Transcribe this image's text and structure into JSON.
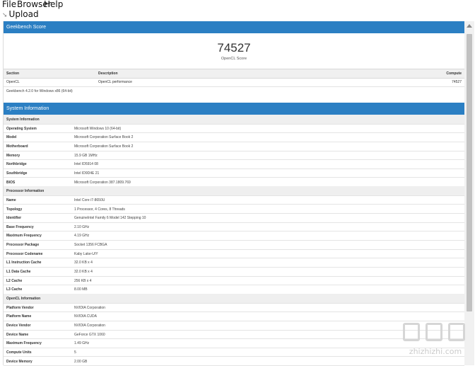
{
  "menu": {
    "file": "File",
    "browser": "Browser",
    "help": "Help"
  },
  "toolbar": {
    "upload": "Upload"
  },
  "score_panel": {
    "title": "Geekbench Score",
    "score": "74527",
    "score_label": "OpenCL Score",
    "headers": {
      "section": "Section",
      "description": "Description",
      "compute": "Compute"
    },
    "row": {
      "section": "OpenCL",
      "description": "OpenCL performance",
      "compute": "74527"
    },
    "version": "Geekbench 4.2.0 for Windows x86 (64-bit)"
  },
  "system_panel": {
    "title": "System Information",
    "rows": [
      {
        "key": "System Information",
        "value": "",
        "section": true
      },
      {
        "key": "Operating System",
        "value": "Microsoft Windows 10 (64-bit)"
      },
      {
        "key": "Model",
        "value": "Microsoft Corporation Surface Book 2"
      },
      {
        "key": "Motherboard",
        "value": "Microsoft Corporation Surface Book 2"
      },
      {
        "key": "Memory",
        "value": "15.9 GB 1MHz"
      },
      {
        "key": "Northbridge",
        "value": "Intel ID5914 08"
      },
      {
        "key": "Southbridge",
        "value": "Intel ID9D4E 21"
      },
      {
        "key": "BIOS",
        "value": "Microsoft Corporation 387.1809.769"
      },
      {
        "key": "Processor Information",
        "value": "",
        "section": true
      },
      {
        "key": "Name",
        "value": "Intel Core i7-8650U"
      },
      {
        "key": "Topology",
        "value": "1 Processor, 4 Cores, 8 Threads"
      },
      {
        "key": "Identifier",
        "value": "GenuineIntel Family 6 Model 142 Stepping 10"
      },
      {
        "key": "Base Frequency",
        "value": "2.10 GHz"
      },
      {
        "key": "Maximum Frequency",
        "value": "4.19 GHz"
      },
      {
        "key": "Processor Package",
        "value": "Socket 1356 FCBGA"
      },
      {
        "key": "Processor Codename",
        "value": "Kaby Lake-U/Y"
      },
      {
        "key": "L1 Instruction Cache",
        "value": "32.0 KB x 4"
      },
      {
        "key": "L1 Data Cache",
        "value": "32.0 KB x 4"
      },
      {
        "key": "L2 Cache",
        "value": "256 KB x 4"
      },
      {
        "key": "L3 Cache",
        "value": "8.00 MB"
      },
      {
        "key": "OpenCL Information",
        "value": "",
        "section": true
      },
      {
        "key": "Platform Vendor",
        "value": "NVIDIA Corporation"
      },
      {
        "key": "Platform Name",
        "value": "NVIDIA CUDA"
      },
      {
        "key": "Device Vendor",
        "value": "NVIDIA Corporation"
      },
      {
        "key": "Device Name",
        "value": "GeForce GTX 1060"
      },
      {
        "key": "Maximum Frequency",
        "value": "1.49 GHz"
      },
      {
        "key": "Compute Units",
        "value": "5"
      },
      {
        "key": "Device Memory",
        "value": "2.00 GB"
      }
    ]
  },
  "watermark": "zhizhizhi.com"
}
